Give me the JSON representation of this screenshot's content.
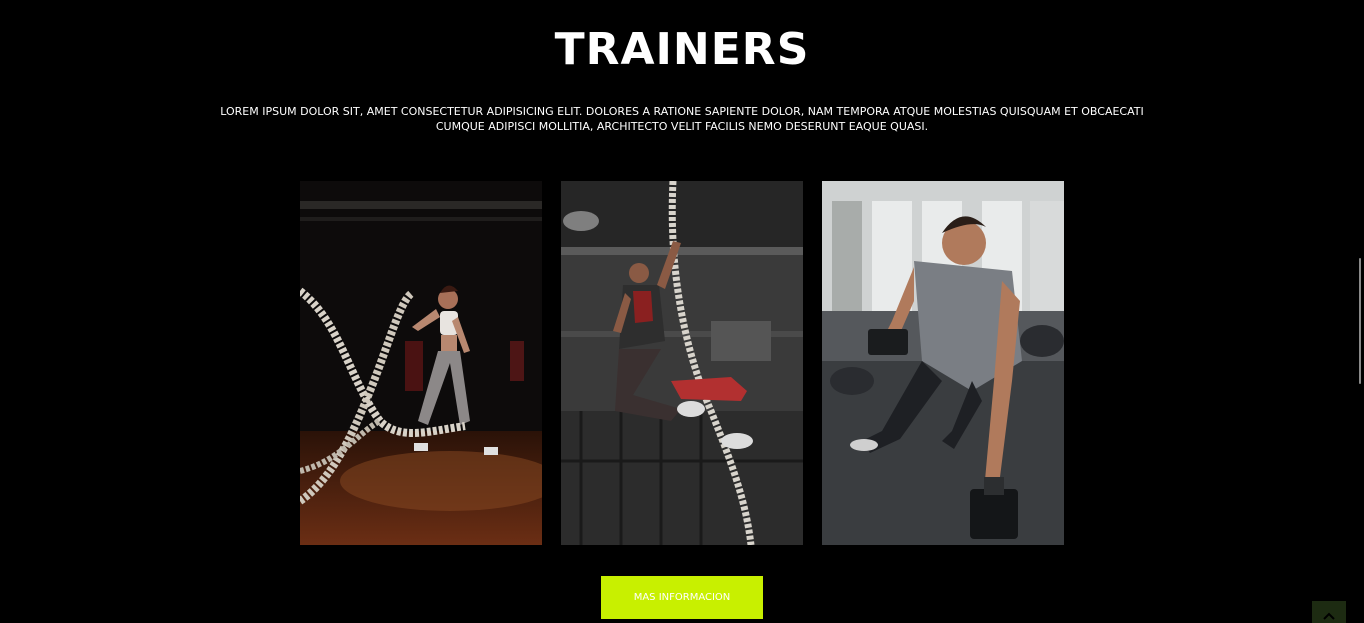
{
  "section": {
    "title": "TRAINERS",
    "description": "LOREM IPSUM DOLOR SIT, AMET CONSECTETUR ADIPISICING ELIT. DOLORES A RATIONE SAPIENTE DOLOR, NAM TEMPORA ATQUE MOLESTIAS QUISQUAM ET OBCAECATI CUMQUE ADIPISCI MOLLITIA, ARCHITECTO VELIT FACILIS NEMO DESERUNT EAQUE QUASI."
  },
  "cta": {
    "label": "MAS INFORMACION"
  },
  "icons": {
    "back_to_top": "chevron-up-icon"
  },
  "colors": {
    "background": "#000000",
    "accent": "#c8f000",
    "text": "#ffffff"
  }
}
